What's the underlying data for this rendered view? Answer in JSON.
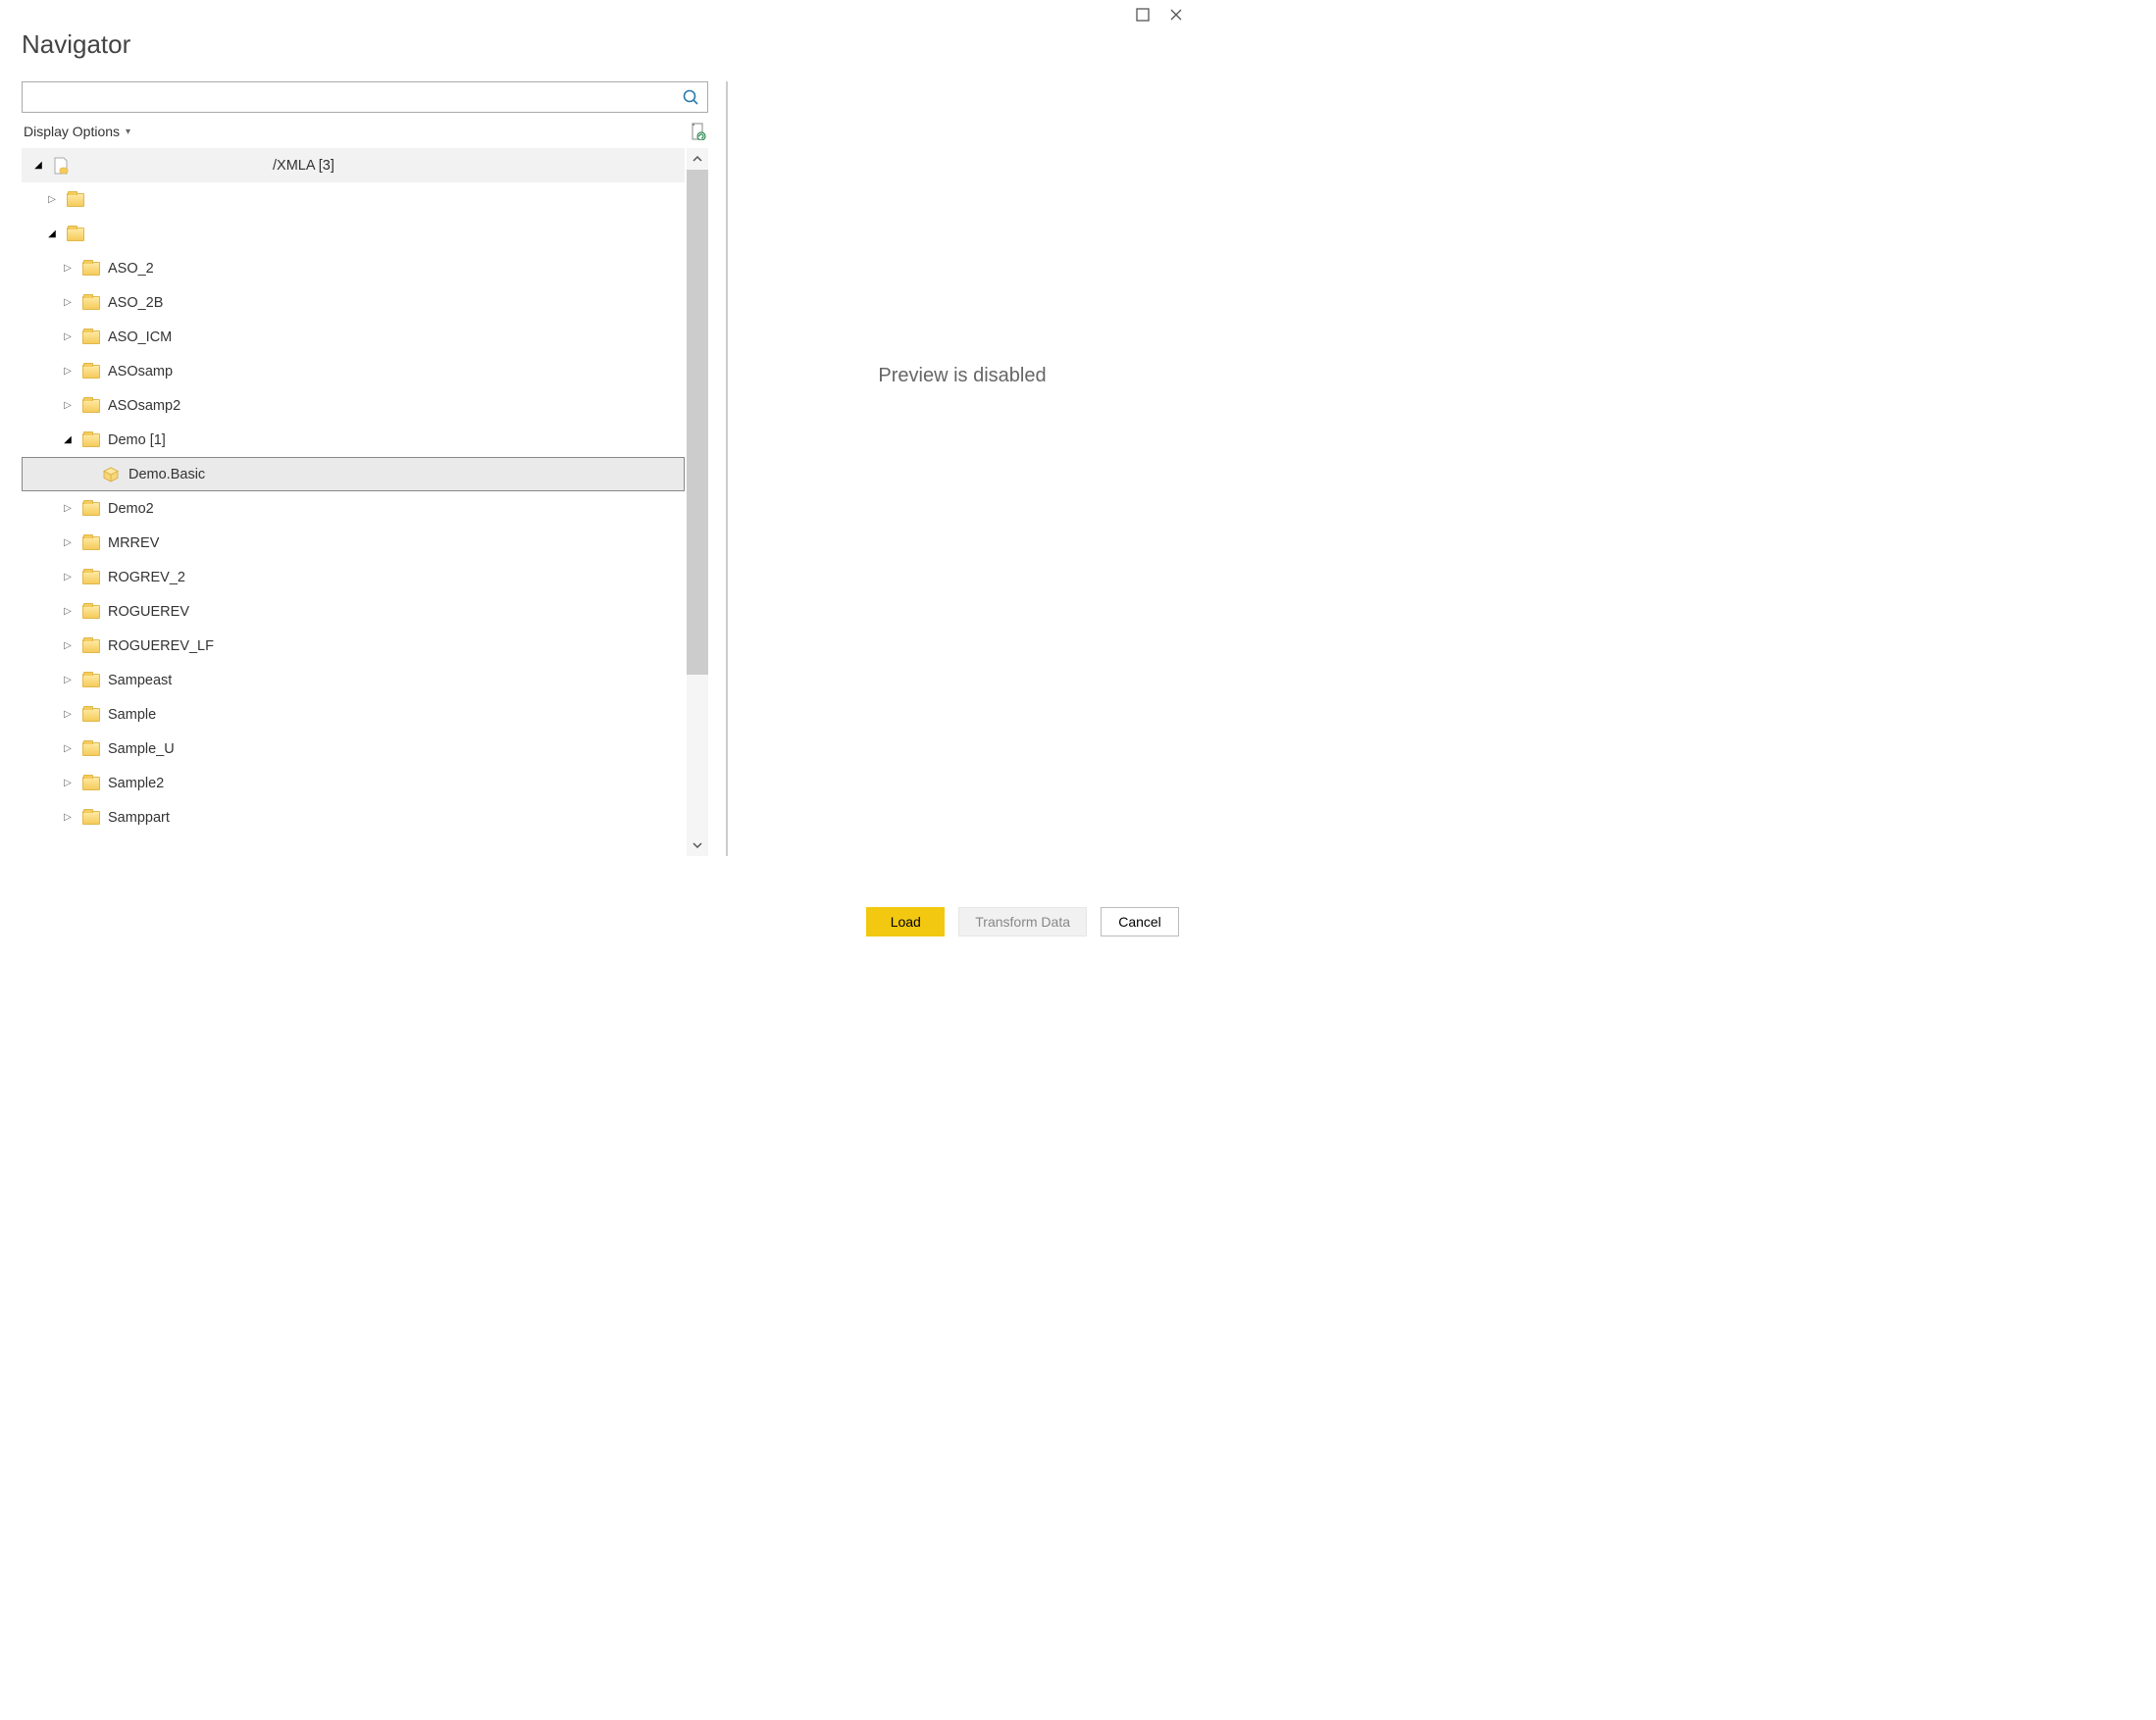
{
  "dialog": {
    "title": "Navigator"
  },
  "search": {
    "value": "",
    "placeholder": ""
  },
  "display_options": {
    "label": "Display Options"
  },
  "tree": {
    "root": {
      "label": "/XMLA [3]"
    },
    "items": [
      {
        "label": "",
        "indent": 1,
        "expander": "collapsed",
        "icon": "folder"
      },
      {
        "label": "",
        "indent": 1,
        "expander": "expanded-down",
        "icon": "folder"
      },
      {
        "label": "ASO_2",
        "indent": 2,
        "expander": "collapsed",
        "icon": "folder"
      },
      {
        "label": "ASO_2B",
        "indent": 2,
        "expander": "collapsed",
        "icon": "folder"
      },
      {
        "label": "ASO_ICM",
        "indent": 2,
        "expander": "collapsed",
        "icon": "folder"
      },
      {
        "label": "ASOsamp",
        "indent": 2,
        "expander": "collapsed",
        "icon": "folder"
      },
      {
        "label": "ASOsamp2",
        "indent": 2,
        "expander": "collapsed",
        "icon": "folder"
      },
      {
        "label": "Demo [1]",
        "indent": 2,
        "expander": "expanded-down",
        "icon": "folder"
      },
      {
        "label": "Demo.Basic",
        "indent": 3,
        "expander": "none",
        "icon": "cube",
        "selected": true
      },
      {
        "label": "Demo2",
        "indent": 2,
        "expander": "collapsed",
        "icon": "folder"
      },
      {
        "label": "MRREV",
        "indent": 2,
        "expander": "collapsed",
        "icon": "folder"
      },
      {
        "label": "ROGREV_2",
        "indent": 2,
        "expander": "collapsed",
        "icon": "folder"
      },
      {
        "label": "ROGUEREV",
        "indent": 2,
        "expander": "collapsed",
        "icon": "folder"
      },
      {
        "label": "ROGUEREV_LF",
        "indent": 2,
        "expander": "collapsed",
        "icon": "folder"
      },
      {
        "label": "Sampeast",
        "indent": 2,
        "expander": "collapsed",
        "icon": "folder"
      },
      {
        "label": "Sample",
        "indent": 2,
        "expander": "collapsed",
        "icon": "folder"
      },
      {
        "label": "Sample_U",
        "indent": 2,
        "expander": "collapsed",
        "icon": "folder"
      },
      {
        "label": "Sample2",
        "indent": 2,
        "expander": "collapsed",
        "icon": "folder"
      },
      {
        "label": "Samppart",
        "indent": 2,
        "expander": "collapsed",
        "icon": "folder"
      }
    ]
  },
  "preview": {
    "message": "Preview is disabled"
  },
  "buttons": {
    "load": "Load",
    "transform": "Transform Data",
    "cancel": "Cancel"
  }
}
